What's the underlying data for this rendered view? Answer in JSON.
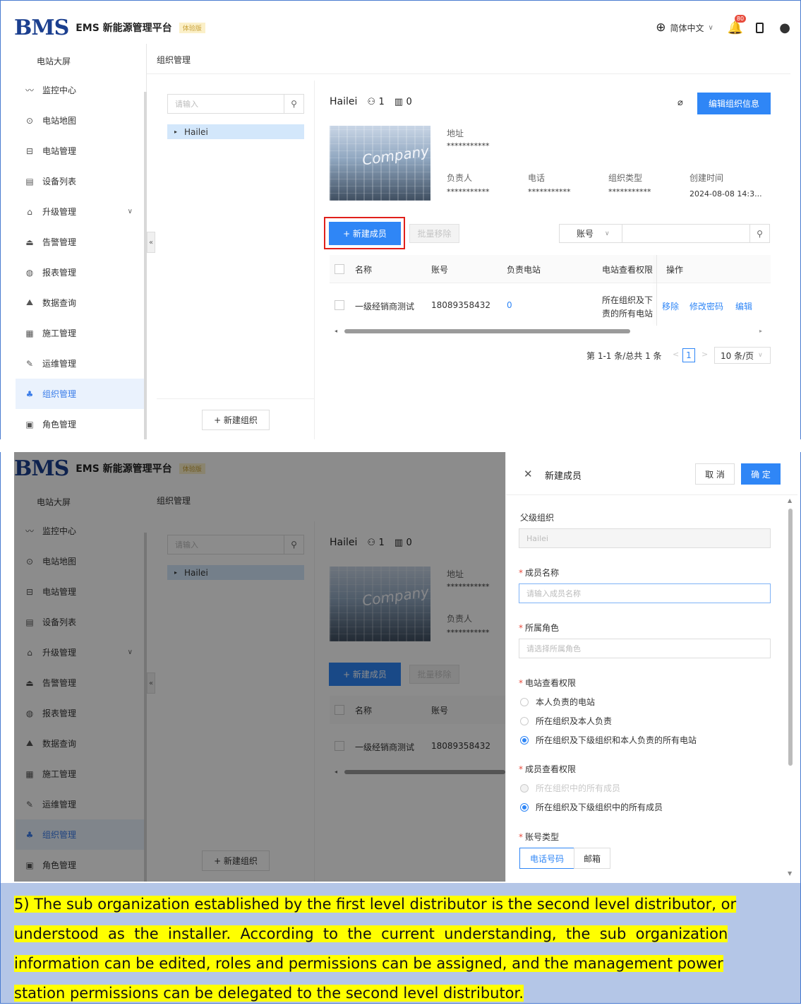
{
  "app": {
    "logo": "BMS",
    "subtitle": "EMS 新能源管理平台",
    "trial_badge": "体验版",
    "language": "简体中文",
    "notification_count": "80"
  },
  "sidebar": {
    "top_item": "电站大屏",
    "items": [
      {
        "label": "监控中心",
        "icon": "〰"
      },
      {
        "label": "电站地图",
        "icon": "⊙"
      },
      {
        "label": "电站管理",
        "icon": "⊟"
      },
      {
        "label": "设备列表",
        "icon": "▤"
      },
      {
        "label": "升级管理",
        "icon": "⌂"
      },
      {
        "label": "告警管理",
        "icon": "⏏"
      },
      {
        "label": "报表管理",
        "icon": "◍"
      },
      {
        "label": "数据查询",
        "icon": "⛰"
      },
      {
        "label": "施工管理",
        "icon": "▦"
      },
      {
        "label": "运维管理",
        "icon": "✎"
      },
      {
        "label": "组织管理",
        "icon": "♣"
      },
      {
        "label": "角色管理",
        "icon": "▣"
      }
    ],
    "active_index": 10
  },
  "breadcrumb": "组织管理",
  "org_tree": {
    "search_placeholder": "请输入",
    "node": "Hailei",
    "new_org_button": "+ 新建组织"
  },
  "org_detail": {
    "name": "Hailei",
    "member_count": "1",
    "station_count": "0",
    "edit_button": "编辑组织信息",
    "image_text": "Company",
    "address_label": "地址",
    "address_value": "***********",
    "owner_label": "负责人",
    "owner_value": "***********",
    "phone_label": "电话",
    "phone_value": "***********",
    "type_label": "组织类型",
    "type_value": "***********",
    "created_label": "创建时间",
    "created_value": "2024-08-08 14:3..."
  },
  "members": {
    "new_member_button": "+ 新建成员",
    "bulk_remove_button": "批量移除",
    "filter_field": "账号",
    "columns": [
      "名称",
      "账号",
      "负责电站",
      "电站查看权限",
      "操作"
    ],
    "rows": [
      {
        "name": "一级经销商测试",
        "account": "18089358432",
        "stations": "0",
        "permission": "所在组织及下\n级组织和本人负\n责的所有电站",
        "permission_line1": "所在组织及下",
        "permission_line2": "责的所有电站",
        "actions": [
          "移除",
          "修改密码",
          "编辑"
        ]
      }
    ],
    "pagination": {
      "summary": "第 1-1 条/总共 1 条",
      "current_page": "1",
      "page_size": "10 条/页"
    }
  },
  "drawer": {
    "title": "新建成员",
    "cancel": "取 消",
    "confirm": "确 定",
    "parent_org_label": "父级组织",
    "parent_org_value": "Hailei",
    "member_name_label": "成员名称",
    "member_name_placeholder": "请输入成员名称",
    "role_label": "所属角色",
    "role_placeholder": "请选择所属角色",
    "station_perm_label": "电站查看权限",
    "station_perm_options": [
      "本人负责的电站",
      "所在组织及本人负责",
      "所在组织及下级组织和本人负责的所有电站"
    ],
    "station_perm_selected": 2,
    "member_perm_label": "成员查看权限",
    "member_perm_options": [
      "所在组织中的所有成员",
      "所在组织及下级组织中的所有成员"
    ],
    "member_perm_selected": 1,
    "account_type_label": "账号类型",
    "account_type_options": [
      "电话号码",
      "邮箱"
    ],
    "account_type_selected": 0
  },
  "caption": {
    "lines": [
      "5) The sub organization established by the first level distributor is the second level distributor, or",
      "understood  as  the  installer.  According  to  the  current  understanding,  the  sub  organization",
      "information can be edited, roles and permissions can be assigned, and the management power",
      "station permissions can be delegated to the second level distributor."
    ]
  },
  "colors": {
    "primary": "#2f86f6",
    "highlight": "#ffff00",
    "caption_bg": "#b4c6e7",
    "annotation_box": "#e0201b"
  }
}
